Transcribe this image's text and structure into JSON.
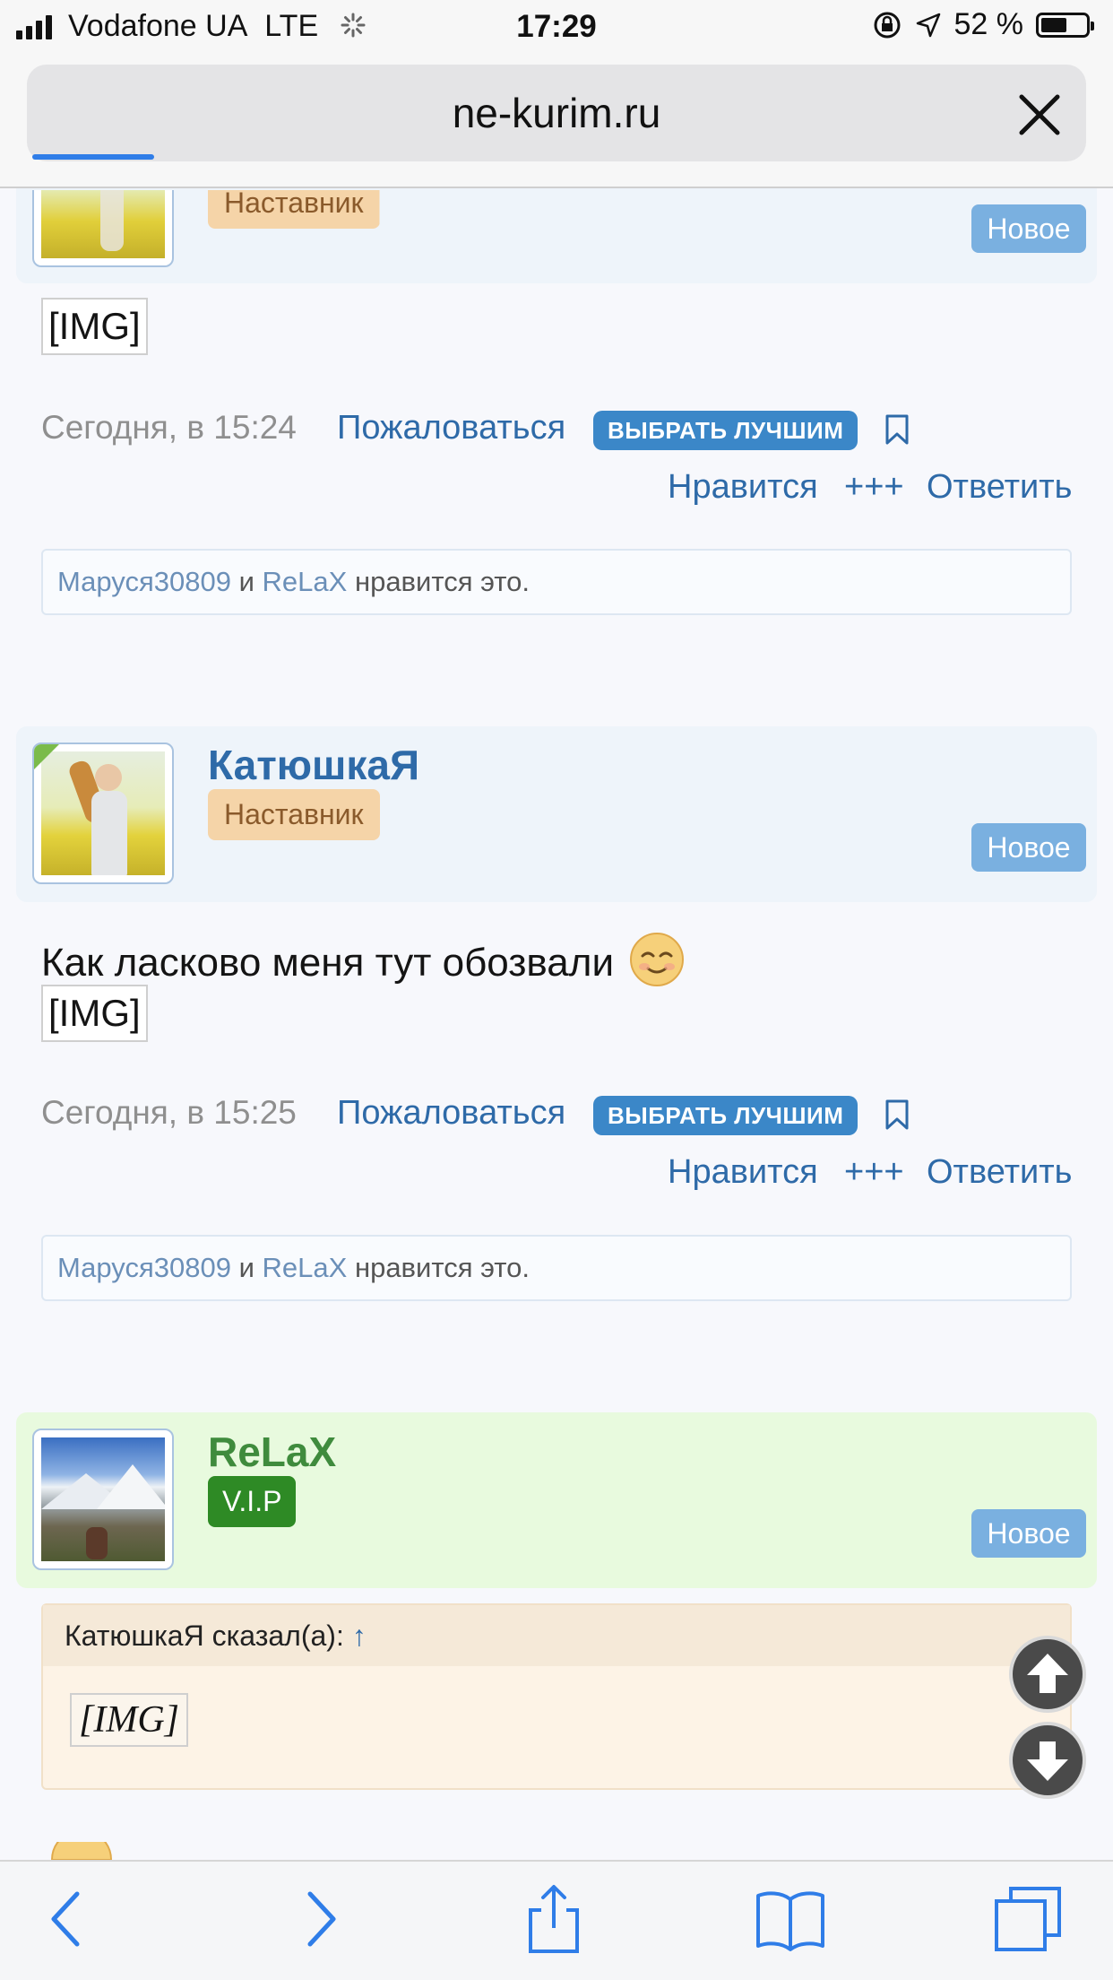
{
  "status_bar": {
    "carrier": "Vodafone UA",
    "network": "LTE",
    "time": "17:29",
    "battery": "52 %"
  },
  "browser": {
    "url": "ne-kurim.ru",
    "load_progress": 0.11
  },
  "posts": [
    {
      "author_role": "Наставник",
      "new_badge": "Новое",
      "image_placeholder": "[IMG]",
      "date": "Сегодня, в 15:24",
      "report": "Пожаловаться",
      "best": "ВЫБРАТЬ ЛУЧШИМ",
      "like": "Нравится",
      "plus": "+++",
      "reply": "Ответить",
      "likes": {
        "user1": "Маруся30809",
        "and": "и",
        "user2": "ReLaX",
        "suffix": "нравится это."
      }
    },
    {
      "author": "КатюшкаЯ",
      "author_role": "Наставник",
      "new_badge": "Новое",
      "text": "Как ласково меня тут обозвали",
      "image_placeholder": "[IMG]",
      "date": "Сегодня, в 15:25",
      "report": "Пожаловаться",
      "best": "ВЫБРАТЬ ЛУЧШИМ",
      "like": "Нравится",
      "plus": "+++",
      "reply": "Ответить",
      "likes": {
        "user1": "Маруся30809",
        "and": "и",
        "user2": "ReLaX",
        "suffix": "нравится это."
      }
    },
    {
      "author": "ReLaX",
      "author_role": "V.I.P",
      "new_badge": "Новое",
      "quote": {
        "header": "КатюшкаЯ сказал(а):",
        "arrow": "↑",
        "image_placeholder": "[IMG]"
      }
    }
  ],
  "colors": {
    "link": "#2e6aa8",
    "vip_badge": "#2e8a25",
    "mentor_badge": "#f5d4a8",
    "new_badge": "#7ab0e0",
    "best_button": "#3b87c8"
  },
  "icons": [
    "back-icon",
    "forward-icon",
    "share-icon",
    "bookmarks-icon",
    "tabs-icon",
    "bookmark-icon",
    "scroll-up-icon",
    "scroll-down-icon",
    "close-icon"
  ]
}
